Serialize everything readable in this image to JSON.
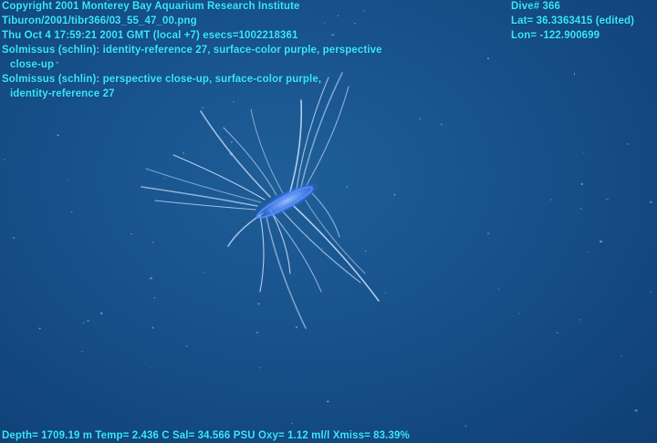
{
  "overlay": {
    "copyright": "Copyright 2001 Monterey Bay Aquarium Research Institute",
    "file_path": "Tiburon/2001/tibr366/03_55_47_00.png",
    "timestamp": "Thu Oct  4 17:59:21 2001 GMT (local +7)  esecs=1002218361",
    "annotation_1": "Solmissus (schlin): identity-reference 27, surface-color purple, perspective",
    "annotation_1_cont": "close-up",
    "annotation_2": "Solmissus (schlin): perspective close-up, surface-color purple,",
    "annotation_2_cont": "identity-reference 27",
    "dive": "Dive# 366",
    "lat": "Lat= 36.3363415 (edited)",
    "lon": "Lon= -122.900699",
    "sensors": "Depth= 1709.19 m  Temp= 2.436 C  Sal= 34.566 PSU  Oxy= 1.12 ml/l  Xmiss= 83.39%"
  },
  "colors": {
    "water": "#17518a",
    "overlay_text": "#38e8ff",
    "jelly_bell": "#3f7cff"
  }
}
